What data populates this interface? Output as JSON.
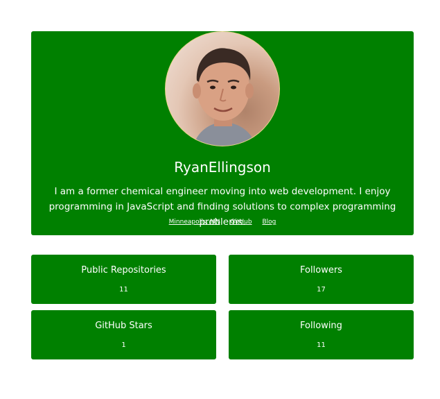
{
  "profile": {
    "name": "RyanEllingson",
    "bio": "I am a former chemical engineer moving into web development. I enjoy programming in JavaScript and finding solutions to complex programming problems.",
    "links": {
      "location": "Minneapolis, MN",
      "github": "GitHub",
      "blog": "Blog"
    },
    "avatar_icon": "profile-photo",
    "accent_color": "#008000"
  },
  "stats": [
    {
      "label": "Public Repositories",
      "value": "11"
    },
    {
      "label": "Followers",
      "value": "17"
    },
    {
      "label": "GitHub Stars",
      "value": "1"
    },
    {
      "label": "Following",
      "value": "11"
    }
  ]
}
